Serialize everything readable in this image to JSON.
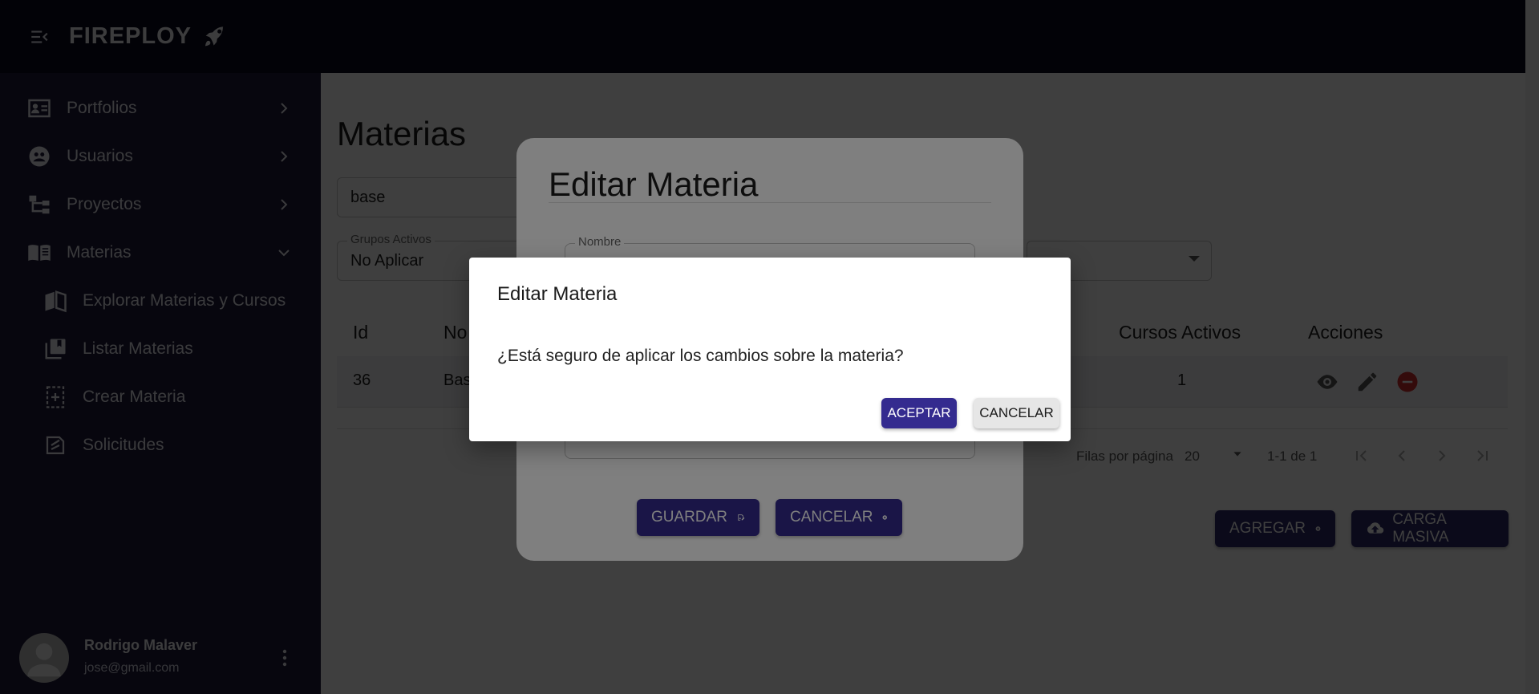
{
  "app": {
    "brand": "FIREPLOY"
  },
  "sidebar": {
    "items": [
      {
        "label": "Portfolios",
        "icon": "portfolio-card-icon"
      },
      {
        "label": "Usuarios",
        "icon": "users-icon"
      },
      {
        "label": "Proyectos",
        "icon": "projects-tree-icon"
      },
      {
        "label": "Materias",
        "icon": "book-icon"
      }
    ],
    "subitems": [
      {
        "label": "Explorar Materias y Cursos",
        "icon": "open-book-icon"
      },
      {
        "label": "Listar Materias",
        "icon": "library-icon"
      },
      {
        "label": "Crear Materia",
        "icon": "add-page-icon"
      },
      {
        "label": "Solicitudes",
        "icon": "request-icon"
      }
    ],
    "user": {
      "name": "Rodrigo Malaver",
      "email": "jose@gmail.com"
    }
  },
  "main": {
    "title": "Materias",
    "search_value": "base",
    "filter": {
      "label": "Grupos Activos",
      "value": "No Aplicar"
    },
    "table": {
      "headers": {
        "id": "Id",
        "name": "No",
        "courses": "Cursos Activos",
        "actions": "Acciones"
      },
      "rows": [
        {
          "id": "36",
          "name": "Bas",
          "courses": "1"
        }
      ]
    },
    "pagination": {
      "rows_label": "Filas por página",
      "rows_value": "20",
      "range": "1-1 de 1"
    },
    "buttons": {
      "add": "AGREGAR",
      "bulk": "CARGA MASIVA"
    }
  },
  "edit_modal": {
    "title": "Editar Materia",
    "field_label": "Nombre",
    "save": "GUARDAR",
    "cancel": "CANCELAR"
  },
  "confirm_dialog": {
    "title": "Editar Materia",
    "message": "¿Está seguro de aplicar los cambios sobre la materia?",
    "accept": "ACEPTAR",
    "cancel": "CANCELAR"
  },
  "colors": {
    "topbar": "#0b0a1c",
    "sidebar": "#1c1a38",
    "primary": "#342b8f",
    "danger": "#d32f2f"
  }
}
